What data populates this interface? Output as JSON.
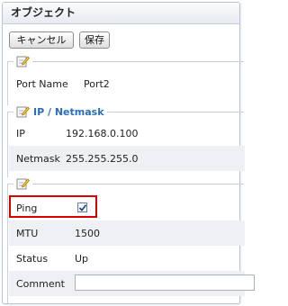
{
  "title": "オブジェクト",
  "toolbar": {
    "cancel_label": "キャンセル",
    "save_label": "保存"
  },
  "general": {
    "port_name_label": "Port Name",
    "port_name_value": "Port2"
  },
  "ip_section": {
    "legend": "IP / Netmask",
    "ip_label": "IP",
    "ip_value": "192.168.0.100",
    "netmask_label": "Netmask",
    "netmask_value": "255.255.255.0"
  },
  "status_section": {
    "ping_label": "Ping",
    "ping_checked": true,
    "mtu_label": "MTU",
    "mtu_value": "1500",
    "status_label": "Status",
    "status_value": "Up",
    "comment_label": "Comment",
    "comment_value": ""
  },
  "colors": {
    "accent": "#2b6fb6",
    "highlight": "#d90000",
    "row_shade": "#eef0f3"
  },
  "icons": [
    "edit-note-icon",
    "checkmark-icon"
  ]
}
